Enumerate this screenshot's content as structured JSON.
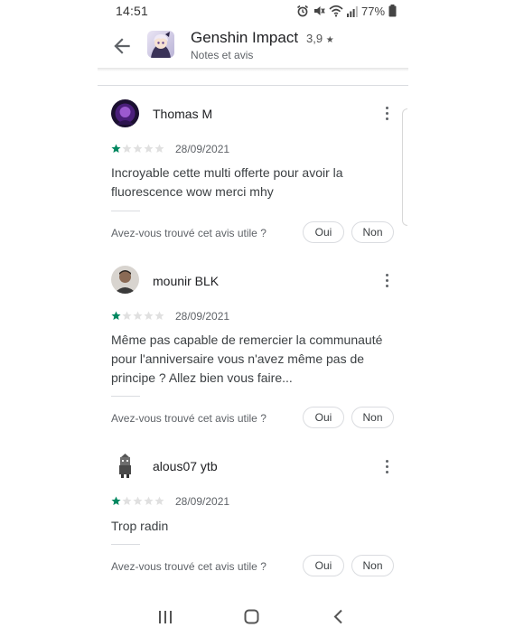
{
  "status_bar": {
    "time": "14:51",
    "battery": "77%",
    "icons": [
      "alarm-icon",
      "mute-icon",
      "wifi-icon",
      "signal-icon",
      "battery-icon"
    ]
  },
  "header": {
    "back_icon": "arrow-left-icon",
    "app_icon": "genshin-app-icon",
    "title": "Genshin Impact",
    "rating": "3,9",
    "rating_icon": "star-icon",
    "subtitle": "Notes et avis"
  },
  "reviews": [
    {
      "author": "Thomas M",
      "stars": 1,
      "max_stars": 5,
      "date": "28/09/2021",
      "text": "Incroyable cette multi offerte pour avoir la fluorescence wow merci mhy",
      "helpful_question": "Avez-vous trouvé cet avis utile ?",
      "yes_label": "Oui",
      "no_label": "Non"
    },
    {
      "author": "mounir BLK",
      "stars": 1,
      "max_stars": 5,
      "date": "28/09/2021",
      "text": "Même pas capable de remercier la communauté pour l'anniversaire vous n'avez même pas de principe ? Allez bien vous faire...",
      "helpful_question": "Avez-vous trouvé cet avis utile ?",
      "yes_label": "Oui",
      "no_label": "Non"
    },
    {
      "author": "alous07 ytb",
      "stars": 1,
      "max_stars": 5,
      "date": "28/09/2021",
      "text": "Trop radin",
      "helpful_question": "Avez-vous trouvé cet avis utile ?",
      "yes_label": "Oui",
      "no_label": "Non"
    }
  ],
  "colors": {
    "star_filled": "#01875f",
    "star_empty": "#e0e0e0",
    "text_primary": "#202124",
    "text_secondary": "#5f6368",
    "border": "#dadce0"
  },
  "nav_bar": {
    "icons": [
      "recent-apps-icon",
      "home-icon",
      "back-icon"
    ]
  }
}
